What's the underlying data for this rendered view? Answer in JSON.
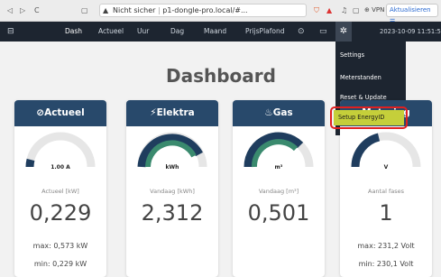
{
  "browser": {
    "back_icon": "◁",
    "forward_icon": "▷",
    "reload_icon": "C",
    "bookmark_icon": "▢",
    "security_warning": "Nicht sicher",
    "url": "p1-dongle-pro.local/#...",
    "vpn_label": "VPN",
    "update_label": "Aktualisieren ☰"
  },
  "nav": {
    "items": [
      "Dash",
      "Actueel",
      "Uur",
      "Dag",
      "Maand",
      "PrijsPlafond"
    ],
    "active": "Dash",
    "datetime": "2023-10-09 11:51:58"
  },
  "dropdown": {
    "items": [
      "Settings",
      "Meterstanden",
      "Reset & Update"
    ],
    "highlighted": "Setup EnergyID"
  },
  "page_title": "Dashboard",
  "cards": [
    {
      "title": "Actueel",
      "icon": "gauge-icon",
      "gauge_label": "1.00 A",
      "gauge_fill": 0.03,
      "sub": "Actueel [kW]",
      "value": "0,229",
      "max": "max: 0,573 kW",
      "min": "min: 0,229 kW"
    },
    {
      "title": "Elektra",
      "icon": "bolt-icon",
      "gauge_label": "kWh",
      "gauge_fill": 0.85,
      "sub": "Vandaag [kWh]",
      "value": "2,312",
      "max": "",
      "min": ""
    },
    {
      "title": "Gas",
      "icon": "flame-icon",
      "gauge_label": "m³",
      "gauge_fill": 0.75,
      "sub": "Vandaag [m³]",
      "value": "0,501",
      "max": "",
      "min": ""
    },
    {
      "title": "Metering",
      "icon": "meter-icon",
      "gauge_label": "V",
      "gauge_fill": 0.4,
      "sub": "Aantal fases",
      "value": "1",
      "max": "max: 231,2 Volt",
      "min": "min: 230,1 Volt"
    }
  ],
  "colors": {
    "nav_bg": "#1d2530",
    "card_head": "#28496b",
    "gauge_dark": "#1f3d5e",
    "gauge_green": "#3a8a6e",
    "highlight": "#e02020",
    "setup_bg": "#c5cf3a"
  }
}
